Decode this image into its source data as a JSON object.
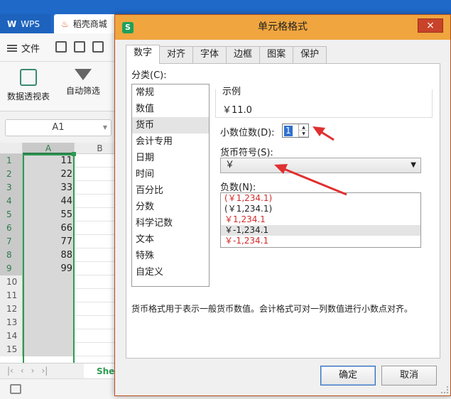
{
  "tabs": {
    "wps": "WPS",
    "docer": "稻壳商城"
  },
  "menu": {
    "file": "文件"
  },
  "ribbon": {
    "pivot": "数据透视表",
    "autofilter": "自动筛选"
  },
  "namebox": "A1",
  "grid": {
    "columns": [
      "A",
      "B"
    ],
    "rows": [
      {
        "n": "1",
        "a": "11"
      },
      {
        "n": "2",
        "a": "22"
      },
      {
        "n": "3",
        "a": "33"
      },
      {
        "n": "4",
        "a": "44"
      },
      {
        "n": "5",
        "a": "55"
      },
      {
        "n": "6",
        "a": "66"
      },
      {
        "n": "7",
        "a": "77"
      },
      {
        "n": "8",
        "a": "88"
      },
      {
        "n": "9",
        "a": "99"
      },
      {
        "n": "10",
        "a": ""
      },
      {
        "n": "11",
        "a": ""
      },
      {
        "n": "12",
        "a": ""
      },
      {
        "n": "13",
        "a": ""
      },
      {
        "n": "14",
        "a": ""
      },
      {
        "n": "15",
        "a": ""
      }
    ]
  },
  "sheet": {
    "tab": "Shee"
  },
  "dialog": {
    "title": "单元格格式",
    "close": "×",
    "tabs": [
      "数字",
      "对齐",
      "字体",
      "边框",
      "图案",
      "保护"
    ],
    "category_label": "分类(C):",
    "categories": [
      "常规",
      "数值",
      "货币",
      "会计专用",
      "日期",
      "时间",
      "百分比",
      "分数",
      "科学记数",
      "文本",
      "特殊",
      "自定义"
    ],
    "sample_label": "示例",
    "sample_value": "￥11.0",
    "decimal_label": "小数位数(D):",
    "decimal_value": "1",
    "currency_label": "货币符号(S):",
    "currency_value": "￥",
    "negative_label": "负数(N):",
    "negatives": [
      "(￥1,234.1)",
      "(￥1,234.1)",
      "￥1,234.1",
      "￥-1,234.1",
      "￥-1,234.1"
    ],
    "description": "货币格式用于表示一般货币数值。会计格式可对一列数值进行小数点对齐。",
    "ok": "确定",
    "cancel": "取消"
  },
  "colors": {
    "accent": "#f0a53f",
    "selection_green": "#2c9b51",
    "negative_red": "#d42a2a",
    "annotation_red": "#e03030"
  }
}
